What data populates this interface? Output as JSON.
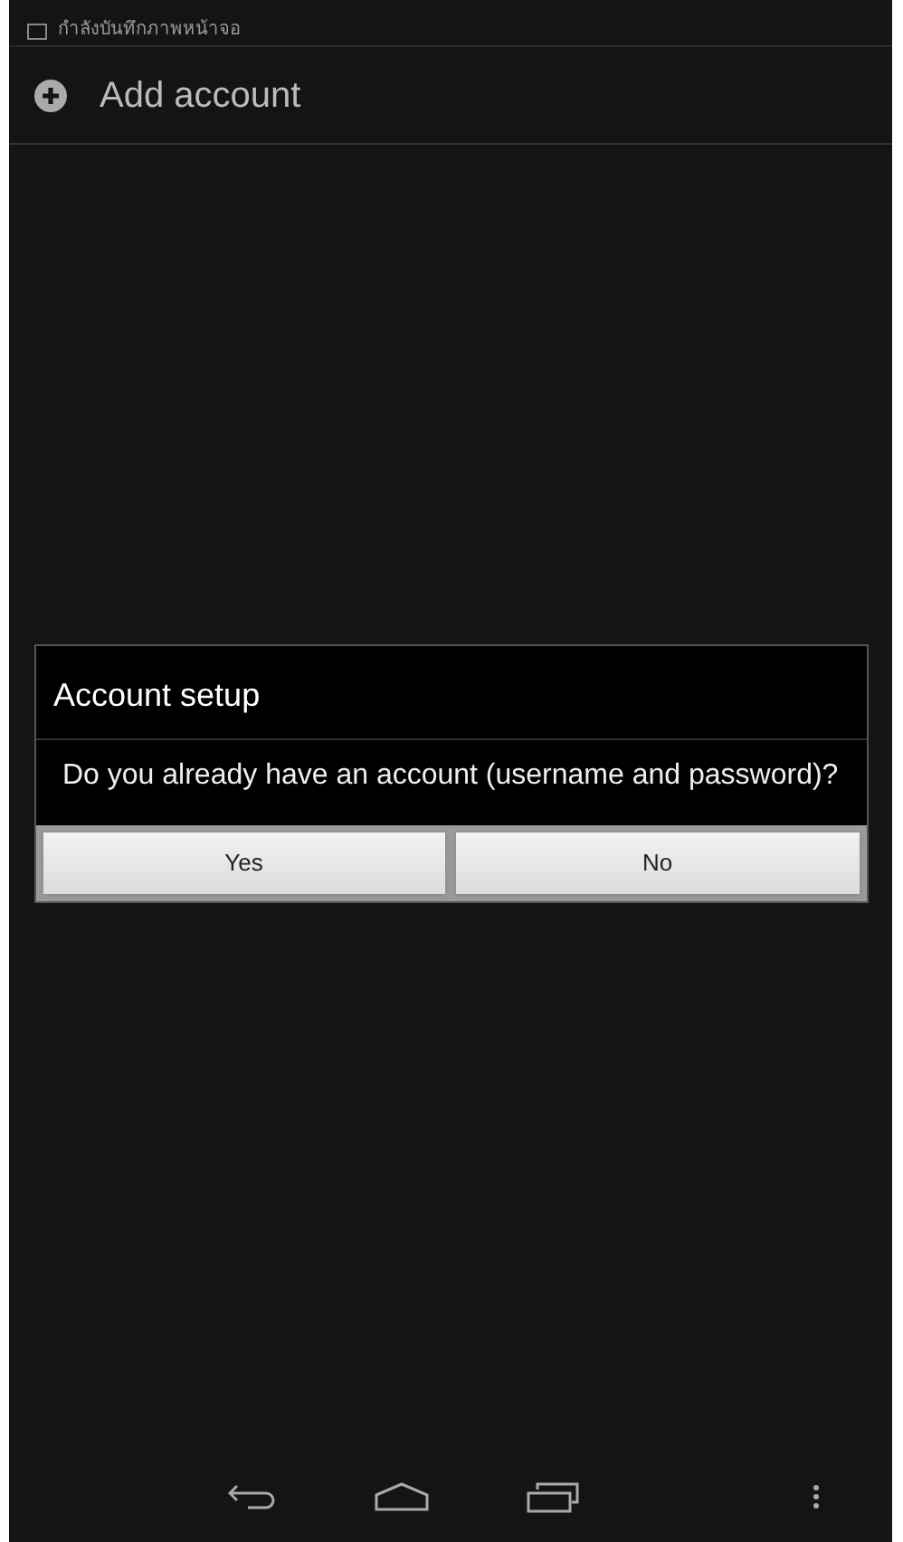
{
  "notification": {
    "text": "กำลังบันทึกภาพหน้าจอ"
  },
  "header": {
    "title": "Add account"
  },
  "dialog": {
    "title": "Account setup",
    "message": "Do you already have an account (username and password)?",
    "buttons": [
      "Yes",
      "No"
    ]
  }
}
